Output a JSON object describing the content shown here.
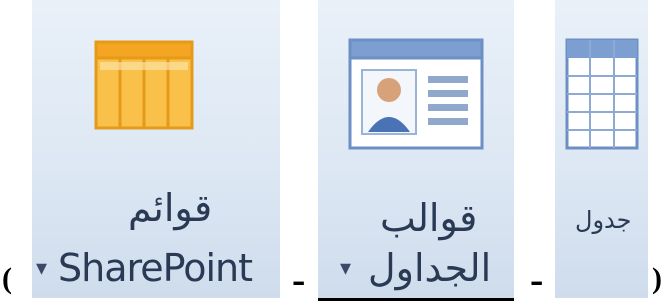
{
  "ribbon": {
    "sharepoint_lists": {
      "label_line1": "قوائم",
      "label_line2": "SharePoint",
      "dropdown_caret": "▾",
      "icon": "sharepoint-list-icon"
    },
    "table_templates": {
      "label_line1": "قوالب",
      "label_line2": "الجداول",
      "dropdown_caret": "▾",
      "icon": "contact-card-icon"
    },
    "table": {
      "label": "جدول",
      "icon": "table-grid-icon"
    }
  },
  "punctuation": {
    "open_paren": "(",
    "close_paren": ")",
    "dash_1": "-",
    "dash_2": "-"
  },
  "colors": {
    "tile_bg": "#dde8f4",
    "icon_orange": "#f6b73c",
    "icon_blue": "#5b7fb8"
  }
}
